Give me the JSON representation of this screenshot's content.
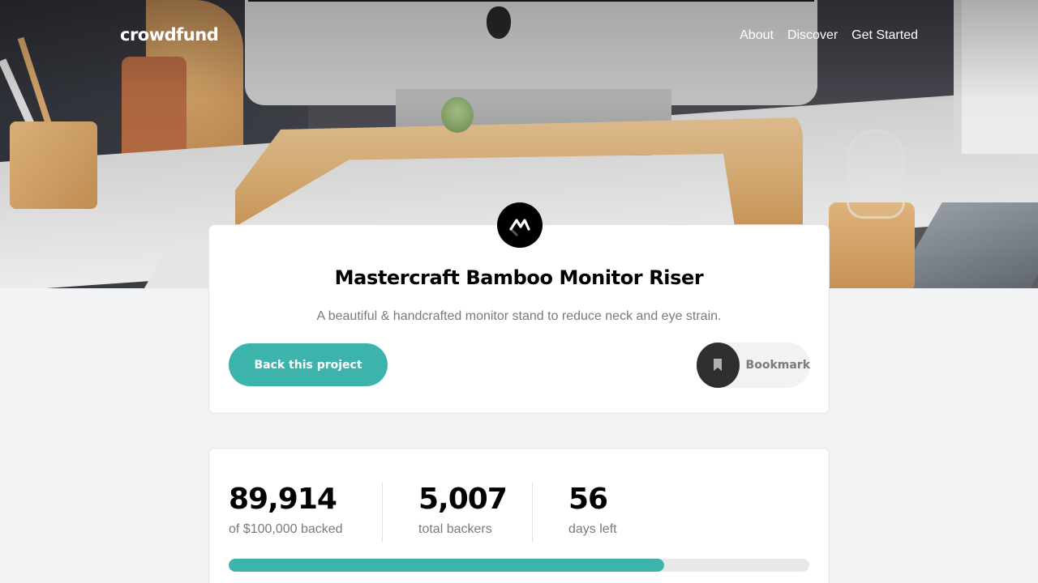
{
  "nav": {
    "logo": "crowdfund",
    "links": [
      "About",
      "Discover",
      "Get Started"
    ]
  },
  "project": {
    "logo_icon": "mastercraft-logo-icon",
    "title": "Mastercraft Bamboo Monitor Riser",
    "description": "A beautiful & handcrafted monitor stand to reduce neck and eye strain.",
    "back_label": "Back this project",
    "bookmark_label": "Bookmark",
    "bookmark_icon": "bookmark-icon"
  },
  "stats": {
    "backed_amount": "89,914",
    "backed_label": "of $100,000 backed",
    "backers": "5,007",
    "backers_label": "total backers",
    "days": "56",
    "days_label": "days left",
    "progress_fraction": 0.75
  },
  "colors": {
    "accent": "#3cb4ac",
    "dark": "#2f2f2f",
    "muted_text": "#7a7a7a",
    "background": "#f2f3f4"
  }
}
